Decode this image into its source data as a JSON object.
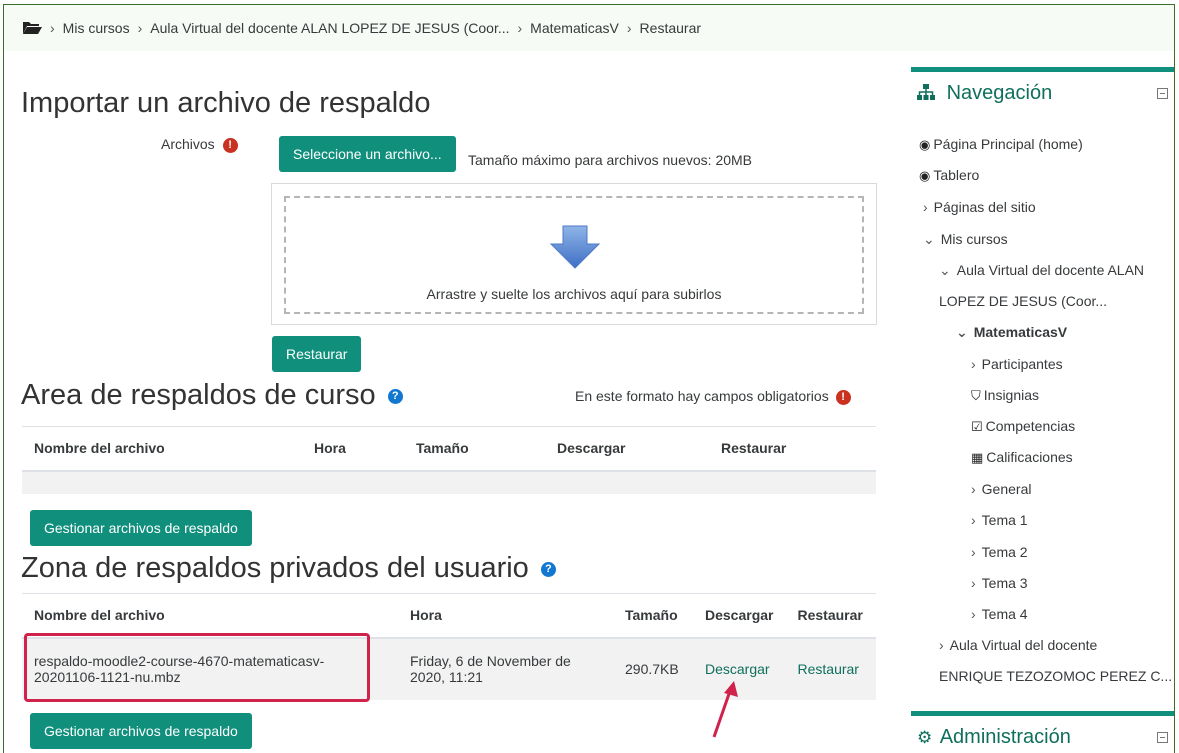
{
  "breadcrumb": {
    "items": [
      "Mis cursos",
      "Aula Virtual del docente ALAN LOPEZ DE JESUS (Coor...",
      "MatematicasV",
      "Restaurar"
    ]
  },
  "import": {
    "title": "Importar un archivo de respaldo",
    "files_label": "Archivos",
    "choose_button": "Seleccione un archivo...",
    "max_size": "Tamaño máximo para archivos nuevos: 20MB",
    "drop_text": "Arrastre y suelte los archivos aquí para subirlos",
    "restore_button": "Restaurar"
  },
  "course_area": {
    "title": "Area de respaldos de curso",
    "required_note": "En este formato hay campos obligatorios",
    "columns": [
      "Nombre del archivo",
      "Hora",
      "Tamaño",
      "Descargar",
      "Restaurar"
    ],
    "manage_button": "Gestionar archivos de respaldo"
  },
  "user_area": {
    "title": "Zona de respaldos privados del usuario",
    "columns": [
      "Nombre del archivo",
      "Hora",
      "Tamaño",
      "Descargar",
      "Restaurar"
    ],
    "rows": [
      {
        "name_line1": "respaldo-moodle2-course-4670-matematicasv-",
        "name_line2": "20201106-1121-nu.mbz",
        "time_line1": "Friday, 6 de November de",
        "time_line2": "2020, 11:21",
        "size": "290.7KB",
        "download": "Descargar",
        "restore": "Restaurar"
      }
    ],
    "manage_button": "Gestionar archivos de respaldo"
  },
  "navigation": {
    "title": "Navegación",
    "items": {
      "home": "Página Principal (home)",
      "dashboard": "Tablero",
      "site_pages": "Páginas del sitio",
      "my_courses": "Mis cursos",
      "course1_line1": "Aula Virtual del docente ALAN",
      "course1_line2": "LOPEZ DE JESUS (Coor...",
      "current_course": "MatematicasV",
      "participants": "Participantes",
      "badges": "Insignias",
      "competencies": "Competencias",
      "grades": "Calificaciones",
      "general": "General",
      "topic1": "Tema 1",
      "topic2": "Tema 2",
      "topic3": "Tema 3",
      "topic4": "Tema 4",
      "course2_line1": "Aula Virtual del docente",
      "course2_line2": "ENRIQUE TEZOZOMOC PEREZ C..."
    }
  },
  "administration": {
    "title": "Administración"
  },
  "colors": {
    "accent": "#0f8f7c",
    "required": "#ca3120",
    "highlight": "#d0234b",
    "help": "#1177d1"
  },
  "icons": [
    "folder-icon",
    "required-icon",
    "down-arrow-icon",
    "help-icon",
    "sitemap-icon",
    "dashboard-icon",
    "shield-icon",
    "checkbox-icon",
    "table-icon",
    "cogs-icon",
    "collapse-icon",
    "chevron-right-icon",
    "chevron-down-icon"
  ]
}
